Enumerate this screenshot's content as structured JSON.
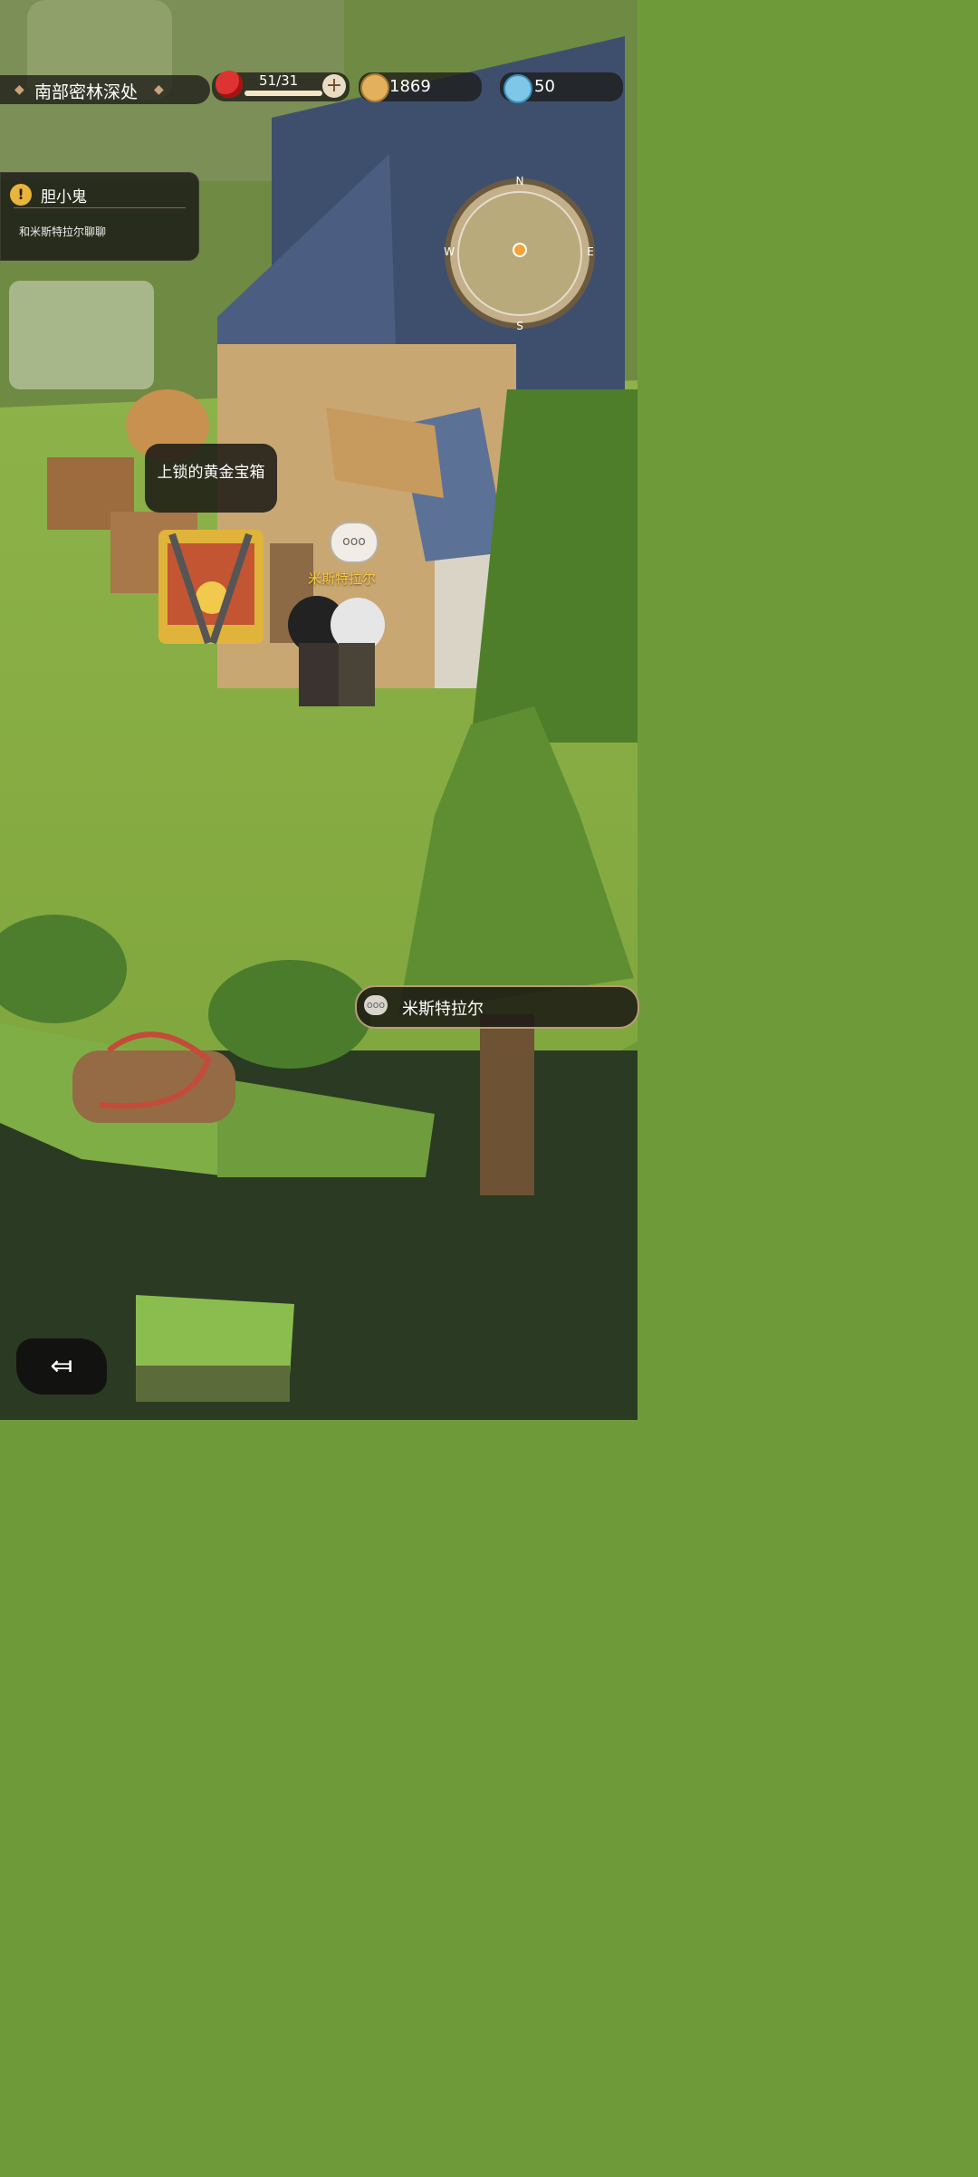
{
  "hud": {
    "location": "南部密林深处",
    "stamina": "51/31",
    "coins": "1869",
    "gems": "50"
  },
  "quest": {
    "title": "胆小鬼",
    "description": "和米斯特拉尔聊聊"
  },
  "world": {
    "chest_label": "上锁的黄金宝箱",
    "npc_name": "米斯特拉尔",
    "npc_bubble": "ooo"
  },
  "interaction": {
    "label": "米斯特拉尔",
    "icon_text": "ooo"
  },
  "minimap": {
    "north": "N",
    "east": "E",
    "south": "S",
    "west": "W"
  },
  "icons": [
    "apple-icon",
    "plus-icon",
    "coin-icon",
    "gem-icon",
    "warning-icon",
    "back-arrow-icon",
    "chat-bubble-icon"
  ],
  "colors": {
    "accent_gold": "#f4c84a",
    "hud_bg": "#1e1c18"
  },
  "resources": {
    "stamina_fill_fraction": 1.0
  }
}
